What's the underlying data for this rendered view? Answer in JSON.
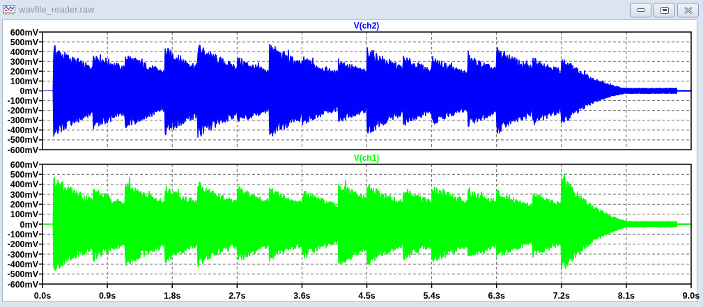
{
  "window": {
    "title": "wavfile_reader.raw"
  },
  "plots": [
    {
      "trace": "V(ch2)",
      "color": "#0000ff",
      "y_ticks": [
        "600mV",
        "500mV",
        "400mV",
        "300mV",
        "200mV",
        "100mV",
        "0mV",
        "-100mV",
        "-200mV",
        "-300mV",
        "-400mV",
        "-500mV",
        "-600mV"
      ]
    },
    {
      "trace": "V(ch1)",
      "color": "#00ff00",
      "y_ticks": [
        "600mV",
        "500mV",
        "400mV",
        "300mV",
        "200mV",
        "100mV",
        "0mV",
        "-100mV",
        "-200mV",
        "-300mV",
        "-400mV",
        "-500mV",
        "-600mV"
      ]
    }
  ],
  "x_ticks": [
    "0.0s",
    "0.9s",
    "1.8s",
    "2.7s",
    "3.6s",
    "4.5s",
    "5.4s",
    "6.3s",
    "7.2s",
    "8.1s",
    "9.0s"
  ]
}
